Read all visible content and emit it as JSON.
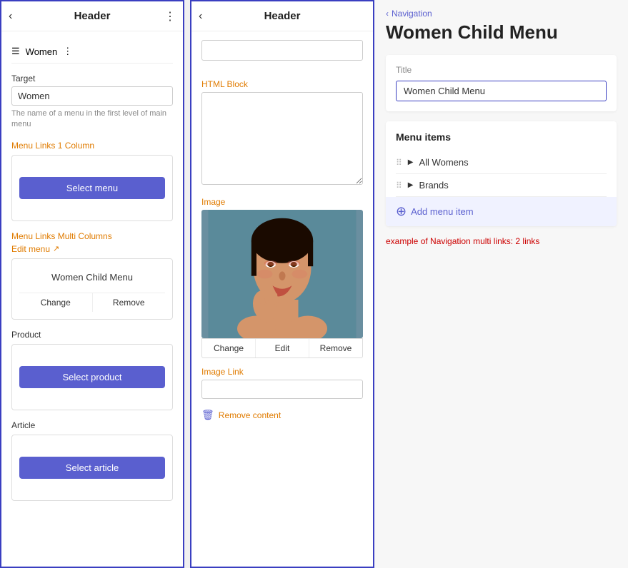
{
  "leftPanel": {
    "header": {
      "back_label": "‹",
      "title": "Header",
      "dots_label": "⋮"
    },
    "navItem": {
      "icon": "☰",
      "label": "Women",
      "dots": "⋮"
    },
    "targetSection": {
      "label": "Target",
      "inputValue": "Women",
      "hint": "The name of a menu in the first level of main menu"
    },
    "menuLinks1Col": {
      "label": "Menu Links 1 Column",
      "selectMenuBtn": "Select menu"
    },
    "menuLinksMultiCol": {
      "label": "Menu Links Multi Columns",
      "editMenuLabel": "Edit menu",
      "editMenuIcon": "↗",
      "selectedName": "Women Child Menu",
      "changeBtn": "Change",
      "removeBtn": "Remove"
    },
    "product": {
      "label": "Product",
      "selectProductBtn": "Select product"
    },
    "article": {
      "label": "Article",
      "selectArticleBtn": "Select article"
    }
  },
  "middlePanel": {
    "header": {
      "back_label": "‹",
      "title": "Header"
    },
    "topInput": {
      "value": "",
      "placeholder": ""
    },
    "htmlBlock": {
      "label": "HTML Block",
      "textareaValue": ""
    },
    "image": {
      "label": "Image",
      "changeBtn": "Change",
      "editBtn": "Edit",
      "removeBtn": "Remove"
    },
    "imageLink": {
      "label": "Image Link",
      "inputValue": ""
    },
    "removeContent": {
      "label": "Remove content",
      "icon": "🗑"
    }
  },
  "rightPanel": {
    "breadcrumb": {
      "chevron": "‹",
      "label": "Navigation"
    },
    "title": "Women Child Menu",
    "titleCard": {
      "fieldLabel": "Title",
      "fieldValue": "Women Child Menu"
    },
    "menuItemsCard": {
      "title": "Menu items",
      "items": [
        {
          "name": "All Womens"
        },
        {
          "name": "Brands"
        }
      ],
      "addLabel": "Add menu item",
      "plusIcon": "⊕"
    },
    "exampleText": "example of Navigation multi links: 2 links"
  }
}
